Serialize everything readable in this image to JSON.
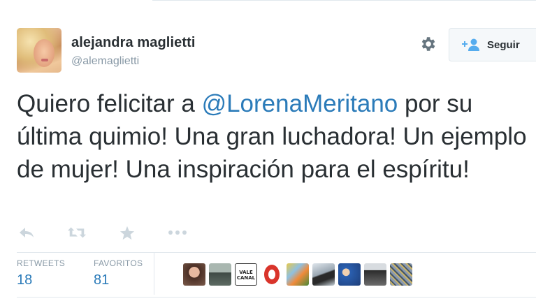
{
  "user": {
    "fullname": "alejandra maglietti",
    "username": "@alemaglietti"
  },
  "follow_button": {
    "label": "Seguir"
  },
  "tweet": {
    "text_before": "Quiero felicitar a ",
    "mention": "@LorenaMeritano",
    "text_after": " por su última quimio! Una gran luchadora! Un ejemplo de mujer! Una inspiración para el espíritu!"
  },
  "actions": [
    "reply-icon",
    "retweet-icon",
    "favorite-icon",
    "more-icon"
  ],
  "stats": {
    "retweets_label": "RETWEETS",
    "retweets_count": "18",
    "favorites_label": "FAVORITOS",
    "favorites_count": "81"
  },
  "favoriters": [
    {
      "icon": "avatar-woman-dark-hair",
      "color": "#7a5a4a"
    },
    {
      "icon": "avatar-landscape",
      "color": "#5d6b63"
    },
    {
      "icon": "avatar-vale-canal-logo",
      "color": "#ffffff",
      "logo_text": "VALE CANAL"
    },
    {
      "icon": "avatar-red-logo",
      "color": "#d9342b"
    },
    {
      "icon": "avatar-colorful-pattern",
      "color": "#e8c94a"
    },
    {
      "icon": "avatar-person-hat",
      "color": "#9aa7b2"
    },
    {
      "icon": "avatar-group-blue",
      "color": "#2a5fb0"
    },
    {
      "icon": "avatar-person-suit",
      "color": "#6c6c6c"
    },
    {
      "icon": "avatar-crowd",
      "color": "#8a9ab0"
    }
  ],
  "colors": {
    "link": "#2b7bb9",
    "muted": "#8899a6",
    "text": "#292f33",
    "border": "#e1e8ed"
  }
}
